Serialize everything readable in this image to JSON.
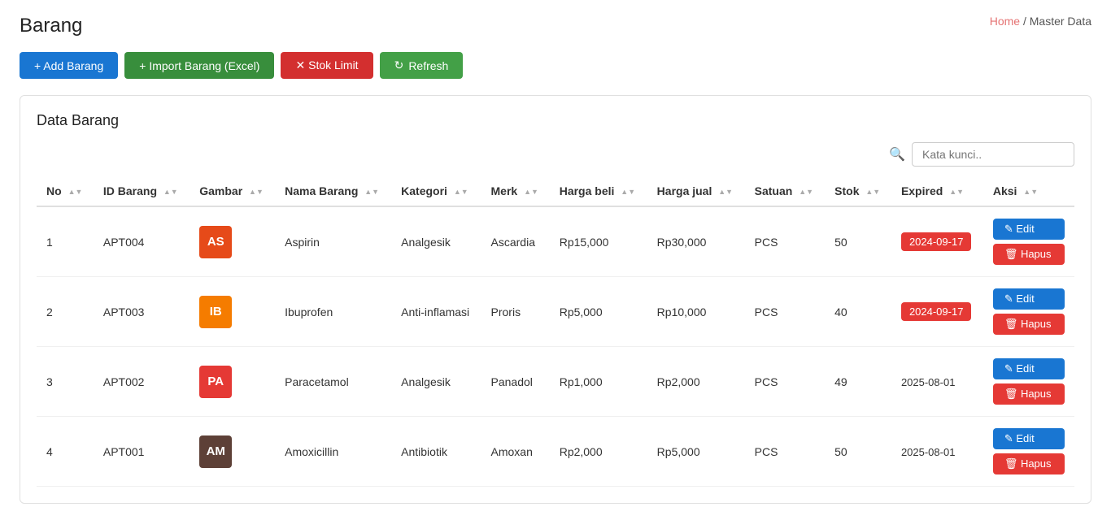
{
  "page": {
    "title": "Barang",
    "breadcrumb_home": "Home",
    "breadcrumb_separator": "/",
    "breadcrumb_current": "Master Data"
  },
  "toolbar": {
    "add_label": "+ Add Barang",
    "import_label": "+ Import Barang (Excel)",
    "stok_label": "✕ Stok Limit",
    "refresh_label": "Refresh"
  },
  "card": {
    "title": "Data Barang"
  },
  "search": {
    "placeholder": "Kata kunci.."
  },
  "table": {
    "columns": [
      "No",
      "ID Barang",
      "Gambar",
      "Nama Barang",
      "Kategori",
      "Merk",
      "Harga beli",
      "Harga jual",
      "Satuan",
      "Stok",
      "Expired",
      "Aksi"
    ],
    "rows": [
      {
        "no": "1",
        "id_barang": "APT004",
        "avatar_text": "AS",
        "avatar_class": "avatar-as",
        "nama_barang": "Aspirin",
        "kategori": "Analgesik",
        "merk": "Ascardia",
        "harga_beli": "Rp15,000",
        "harga_jual": "Rp30,000",
        "satuan": "PCS",
        "stok": "50",
        "expired": "2024-09-17",
        "expired_red": true
      },
      {
        "no": "2",
        "id_barang": "APT003",
        "avatar_text": "IB",
        "avatar_class": "avatar-ib",
        "nama_barang": "Ibuprofen",
        "kategori": "Anti-inflamasi",
        "merk": "Proris",
        "harga_beli": "Rp5,000",
        "harga_jual": "Rp10,000",
        "satuan": "PCS",
        "stok": "40",
        "expired": "2024-09-17",
        "expired_red": true
      },
      {
        "no": "3",
        "id_barang": "APT002",
        "avatar_text": "PA",
        "avatar_class": "avatar-pa",
        "nama_barang": "Paracetamol",
        "kategori": "Analgesik",
        "merk": "Panadol",
        "harga_beli": "Rp1,000",
        "harga_jual": "Rp2,000",
        "satuan": "PCS",
        "stok": "49",
        "expired": "2025-08-01",
        "expired_red": false
      },
      {
        "no": "4",
        "id_barang": "APT001",
        "avatar_text": "AM",
        "avatar_class": "avatar-am",
        "nama_barang": "Amoxicillin",
        "kategori": "Antibiotik",
        "merk": "Amoxan",
        "harga_beli": "Rp2,000",
        "harga_jual": "Rp5,000",
        "satuan": "PCS",
        "stok": "50",
        "expired": "2025-08-01",
        "expired_red": false
      }
    ],
    "edit_label": "✎ Edit",
    "hapus_label": "🗑 Hapus"
  }
}
